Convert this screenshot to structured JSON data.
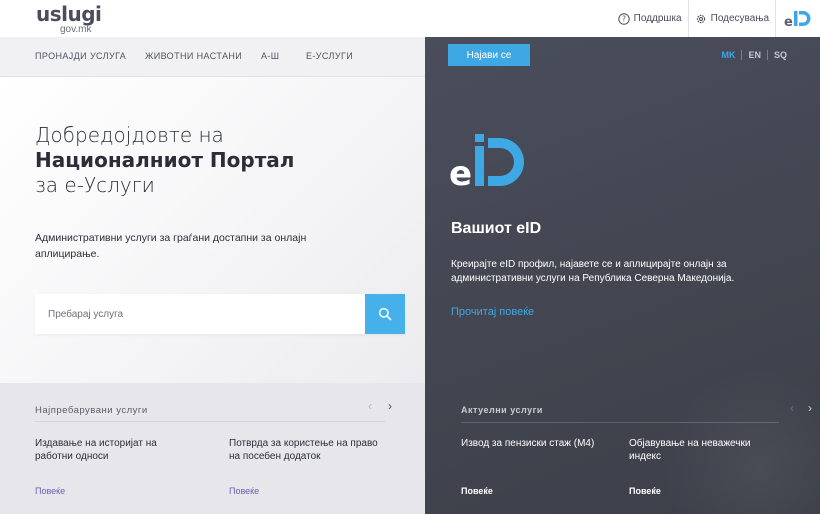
{
  "header": {
    "logo_brand": "uslugi",
    "logo_domain": "gov.mk",
    "support_label": "Поддршка",
    "settings_label": "Подесувања",
    "eid_label": "eID"
  },
  "nav": {
    "items": [
      {
        "label": "ПРОНАЈДИ УСЛУГА"
      },
      {
        "label": "ЖИВОТНИ НАСТАНИ"
      },
      {
        "label": "А-Ш"
      },
      {
        "label": "Е-УСЛУГИ"
      }
    ]
  },
  "auth": {
    "login_label": "Најави се"
  },
  "languages": [
    {
      "code": "MK",
      "active": true
    },
    {
      "code": "EN",
      "active": false
    },
    {
      "code": "SQ",
      "active": false
    }
  ],
  "hero": {
    "title_line1": "Добредојдовте на",
    "title_line2": "Националниот Портал",
    "title_line3": "за е-Услуги",
    "subtitle": "Административни услуги за граѓани достапни за онлајн аплицирање.",
    "search_placeholder": "Пребарај услуга"
  },
  "eid_panel": {
    "logo_text": "eiD",
    "title": "Вашиот eID",
    "description": "Креирајте eID профил, најавете се и аплицирајте онлајн за административни услуги на Република Северна Македонија.",
    "read_more": "Прочитај повеќе"
  },
  "popular": {
    "title": "Најпребарувани услуги",
    "items": [
      {
        "label": "Издавање на историјат на работни односи",
        "more": "Повеќе"
      },
      {
        "label": "Потврда за користење на право на посебен додаток",
        "more": "Повеќе"
      }
    ]
  },
  "current": {
    "title": "Актуелни услуги",
    "items": [
      {
        "label": "Извод за пензиски стаж (М4)",
        "more": "Повеќе"
      },
      {
        "label": "Објавување на неважечки индекс",
        "more": "Повеќе"
      }
    ]
  },
  "colors": {
    "accent": "#3ea8e4",
    "panel_dark": "#46495a",
    "text_dark": "#2b2e3a"
  }
}
